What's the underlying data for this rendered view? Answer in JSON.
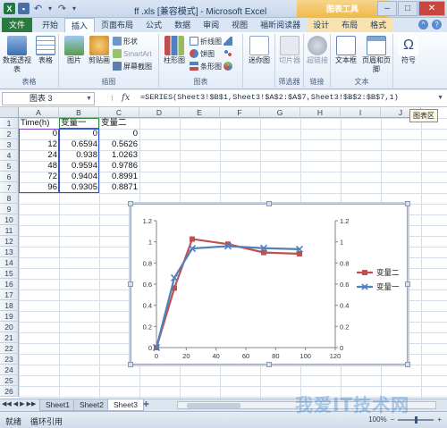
{
  "window": {
    "title": "ff .xls  [兼容模式] - Microsoft Excel",
    "context_tool_label": "图表工具",
    "min": "–",
    "max": "□",
    "close": "✕"
  },
  "ribbon_tabs": [
    "开始",
    "插入",
    "页面布局",
    "公式",
    "数据",
    "审阅",
    "视图",
    "福昕阅读器",
    "设计",
    "布局",
    "格式"
  ],
  "active_tab": "插入",
  "file_tab": "文件",
  "ribbon": {
    "table_group": {
      "items": [
        "数据透视表",
        "表格"
      ],
      "label": "表格"
    },
    "illus_group": {
      "items": [
        "图片",
        "剪贴画",
        "形状",
        "SmartArt",
        "屏幕截图"
      ],
      "label": "插图"
    },
    "chart_group": {
      "items": [
        "柱形图",
        "折线图",
        "饼图",
        "条形图",
        "面积图",
        "散点图",
        "其他图表"
      ],
      "label": "图表"
    },
    "spark_group": {
      "items": [
        "迷你图"
      ],
      "label": ""
    },
    "filter_group": {
      "items": [
        "切片器"
      ],
      "label": "筛选器"
    },
    "link_group": {
      "items": [
        "超链接"
      ],
      "label": "链接"
    },
    "text_group": {
      "items": [
        "文本框",
        "页眉和页脚"
      ],
      "label": "文本"
    },
    "symbol_group": {
      "items": [
        "符号"
      ],
      "label": ""
    }
  },
  "formula_bar": {
    "name_box": "图表 3",
    "fx": "fx",
    "formula": "=SERIES(Sheet3!$B$1,Sheet3!$A$2:$A$7,Sheet3!$B$2:$B$7,1)"
  },
  "sheet": {
    "columns": [
      "A",
      "B",
      "C",
      "D",
      "E",
      "F",
      "G",
      "H",
      "I",
      "J"
    ],
    "rows": [
      "1",
      "2",
      "3",
      "4",
      "5",
      "6",
      "7",
      "8",
      "9",
      "10",
      "11",
      "12",
      "13",
      "14",
      "15",
      "16",
      "17",
      "18",
      "19",
      "20",
      "21",
      "22",
      "23",
      "24",
      "25",
      "26"
    ],
    "header": [
      "Time(h)",
      "变量一",
      "变量二"
    ],
    "data": [
      [
        "0",
        "0",
        "0"
      ],
      [
        "12",
        "0.6594",
        "0.5626"
      ],
      [
        "24",
        "0.938",
        "1.0263"
      ],
      [
        "48",
        "0.9594",
        "0.9786"
      ],
      [
        "72",
        "0.9404",
        "0.8991"
      ],
      [
        "96",
        "0.9305",
        "0.8871"
      ]
    ]
  },
  "chart_tip": "图表区",
  "chart_data": {
    "type": "line",
    "x": [
      0,
      12,
      24,
      48,
      72,
      96
    ],
    "series": [
      {
        "name": "变量二",
        "values": [
          0,
          0.5626,
          1.0263,
          0.9786,
          0.8991,
          0.8871
        ],
        "color": "#c0504d"
      },
      {
        "name": "变量一",
        "values": [
          0,
          0.6594,
          0.938,
          0.9594,
          0.9404,
          0.9305
        ],
        "color": "#4f81bd"
      }
    ],
    "xlim": [
      0,
      120
    ],
    "ylim": [
      0,
      1.2
    ],
    "xticks": [
      "0",
      "20",
      "40",
      "60",
      "80",
      "100",
      "120"
    ],
    "yticks": [
      "0",
      "0.2",
      "0.4",
      "0.6",
      "0.8",
      "1",
      "1.2"
    ],
    "secondary_yticks": [
      "0",
      "0.2",
      "0.4",
      "0.6",
      "0.8",
      "1",
      "1.2"
    ],
    "grid": false,
    "legend": "right",
    "title": "",
    "xlabel": "",
    "ylabel": ""
  },
  "sheet_tabs": [
    "Sheet1",
    "Sheet2",
    "Sheet3"
  ],
  "active_sheet": "Sheet3",
  "status": {
    "mode": "就绪",
    "msg": "循环引用",
    "zoom": "100%"
  },
  "watermark": "我爱IT技术网"
}
